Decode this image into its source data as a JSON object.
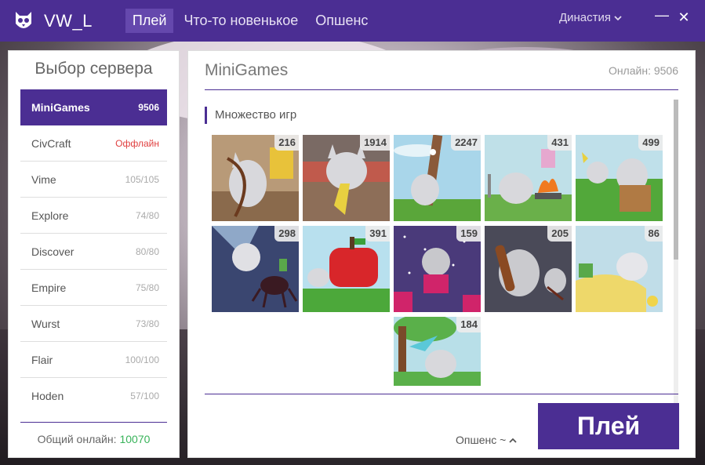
{
  "window": {
    "app_name": "VW_L",
    "nav": [
      "Плей",
      "Что-то новенькое",
      "Опшенс"
    ],
    "account_label": "Династия",
    "minimize_glyph": "—",
    "close_glyph": "✕"
  },
  "sidebar": {
    "title": "Выбор сервера",
    "servers": [
      {
        "name": "MiniGames",
        "count": "9506",
        "active": true
      },
      {
        "name": "CivCraft",
        "count": "Оффлайн",
        "offline": true
      },
      {
        "name": "Vime",
        "count": "105/105"
      },
      {
        "name": "Explore",
        "count": "74/80"
      },
      {
        "name": "Discover",
        "count": "80/80"
      },
      {
        "name": "Empire",
        "count": "75/80"
      },
      {
        "name": "Wurst",
        "count": "73/80"
      },
      {
        "name": "Flair",
        "count": "100/100"
      },
      {
        "name": "Hoden",
        "count": "57/100"
      }
    ],
    "total_label": "Общий онлайн:",
    "total_value": "10070"
  },
  "main": {
    "title": "MiniGames",
    "online_text": "Онлайн: 9506",
    "section_title": "Множество игр",
    "games": [
      {
        "count": "216",
        "icon": "cat-bow-game-icon"
      },
      {
        "count": "1914",
        "icon": "cat-bed-game-icon"
      },
      {
        "count": "2247",
        "icon": "cat-tree-game-icon"
      },
      {
        "count": "431",
        "icon": "cat-fire-game-icon"
      },
      {
        "count": "499",
        "icon": "cat-chest-game-icon"
      },
      {
        "count": "298",
        "icon": "cat-spider-game-icon"
      },
      {
        "count": "391",
        "icon": "cat-apple-game-icon"
      },
      {
        "count": "159",
        "icon": "cat-night-game-icon"
      },
      {
        "count": "205",
        "icon": "cat-club-game-icon"
      },
      {
        "count": "86",
        "icon": "cat-sand-game-icon"
      },
      {
        "count": "184",
        "icon": "cat-forest-game-icon"
      }
    ],
    "options_label": "Опшенс ~",
    "play_label": "Плей"
  },
  "colors": {
    "accent": "#4b2e93",
    "online": "#38b35a",
    "offline": "#e04040"
  }
}
